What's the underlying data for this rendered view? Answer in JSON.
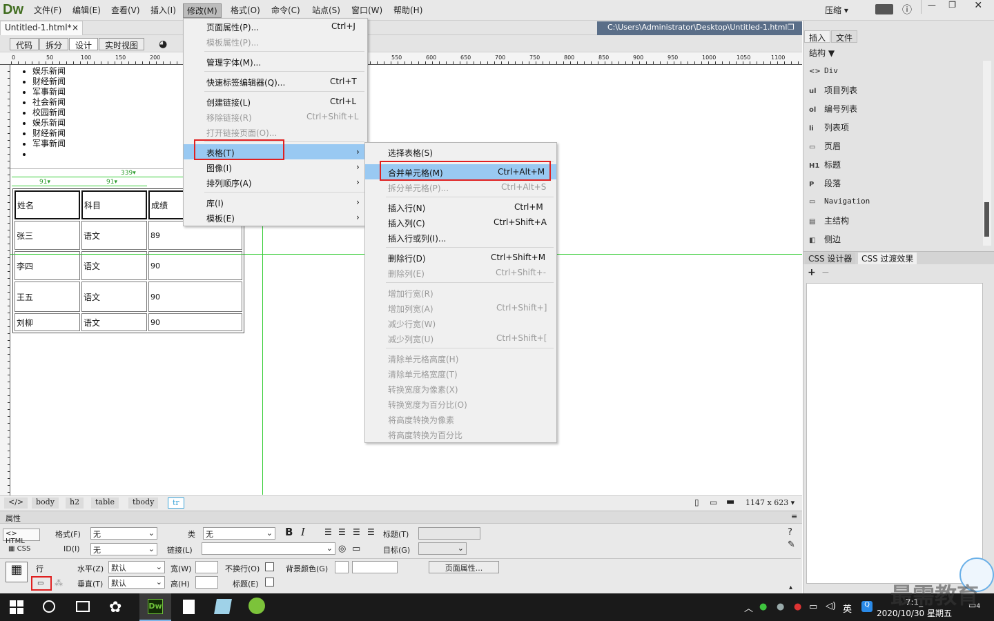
{
  "app": {
    "logo": "Dw",
    "compress": "压缩",
    "compress_arrow": "▾"
  },
  "menubar": [
    "文件(F)",
    "编辑(E)",
    "查看(V)",
    "插入(I)",
    "修改(M)",
    "格式(O)",
    "命令(C)",
    "站点(S)",
    "窗口(W)",
    "帮助(H)"
  ],
  "document": {
    "tab": "Untitled-1.html*",
    "path": "C:\\Users\\Administrator\\Desktop\\Untitled-1.html"
  },
  "view_buttons": [
    "代码",
    "拆分",
    "设计",
    "实时视图"
  ],
  "ruler_marks": [
    "0",
    "50",
    "100",
    "150",
    "200",
    "550",
    "600",
    "650",
    "700",
    "750",
    "800",
    "850",
    "900",
    "950",
    "1000",
    "1050",
    "1100"
  ],
  "list_items": [
    "娱乐新闻",
    "财经新闻",
    "军事新闻",
    "社会新闻",
    "校园新闻",
    "娱乐新闻",
    "财经新闻",
    "军事新闻",
    ""
  ],
  "table_widths": {
    "total": "339",
    "col1": "91",
    "col2": "91"
  },
  "table": [
    [
      "姓名",
      "科目",
      "成绩"
    ],
    [
      "张三",
      "语文",
      "89"
    ],
    [
      "李四",
      "语文",
      "90"
    ],
    [
      "王五",
      "语文",
      "90"
    ],
    [
      "刘柳",
      "语文",
      "90"
    ]
  ],
  "modify_menu": [
    {
      "label": "页面属性(P)...",
      "shortcut": "Ctrl+J",
      "disabled": false
    },
    {
      "label": "模板属性(P)...",
      "shortcut": "",
      "disabled": true
    },
    {
      "label": "管理字体(M)...",
      "shortcut": "",
      "disabled": false
    },
    {
      "label": "快速标签编辑器(Q)...",
      "shortcut": "Ctrl+T",
      "disabled": false
    },
    {
      "label": "创建链接(L)",
      "shortcut": "Ctrl+L",
      "disabled": false
    },
    {
      "label": "移除链接(R)",
      "shortcut": "Ctrl+Shift+L",
      "disabled": true
    },
    {
      "label": "打开链接页面(O)...",
      "shortcut": "",
      "disabled": true
    },
    {
      "label": "表格(T)",
      "shortcut": "›",
      "disabled": false
    },
    {
      "label": "图像(I)",
      "shortcut": "›",
      "disabled": false
    },
    {
      "label": "排列顺序(A)",
      "shortcut": "›",
      "disabled": false
    },
    {
      "label": "库(I)",
      "shortcut": "›",
      "disabled": false
    },
    {
      "label": "模板(E)",
      "shortcut": "›",
      "disabled": false
    }
  ],
  "table_submenu": [
    {
      "label": "选择表格(S)",
      "shortcut": "",
      "disabled": false
    },
    {
      "label": "合并单元格(M)",
      "shortcut": "Ctrl+Alt+M",
      "disabled": false
    },
    {
      "label": "拆分单元格(P)...",
      "shortcut": "Ctrl+Alt+S",
      "disabled": true
    },
    {
      "label": "插入行(N)",
      "shortcut": "Ctrl+M",
      "disabled": false
    },
    {
      "label": "插入列(C)",
      "shortcut": "Ctrl+Shift+A",
      "disabled": false
    },
    {
      "label": "插入行或列(I)...",
      "shortcut": "",
      "disabled": false
    },
    {
      "label": "删除行(D)",
      "shortcut": "Ctrl+Shift+M",
      "disabled": false
    },
    {
      "label": "删除列(E)",
      "shortcut": "Ctrl+Shift+-",
      "disabled": true
    },
    {
      "label": "增加行宽(R)",
      "shortcut": "",
      "disabled": true
    },
    {
      "label": "增加列宽(A)",
      "shortcut": "Ctrl+Shift+]",
      "disabled": true
    },
    {
      "label": "减少行宽(W)",
      "shortcut": "",
      "disabled": true
    },
    {
      "label": "减少列宽(U)",
      "shortcut": "Ctrl+Shift+[",
      "disabled": true
    },
    {
      "label": "清除单元格高度(H)",
      "shortcut": "",
      "disabled": true
    },
    {
      "label": "清除单元格宽度(T)",
      "shortcut": "",
      "disabled": true
    },
    {
      "label": "转换宽度为像素(X)",
      "shortcut": "",
      "disabled": true
    },
    {
      "label": "转换宽度为百分比(O)",
      "shortcut": "",
      "disabled": true
    },
    {
      "label": "将高度转换为像素",
      "shortcut": "",
      "disabled": true
    },
    {
      "label": "将高度转换为百分比",
      "shortcut": "",
      "disabled": true
    }
  ],
  "tag_selector": [
    "</>",
    "body",
    "h2",
    "table",
    "tbody",
    "tr"
  ],
  "window_size": "1147 x 623 ▾",
  "properties": {
    "title": "属性",
    "html": "HTML",
    "css": "CSS",
    "format_label": "格式(F)",
    "format_value": "无",
    "class_label": "类",
    "class_value": "无",
    "id_label": "ID(I)",
    "id_value": "无",
    "link_label": "链接(L)",
    "title_label": "标题(T)",
    "target_label": "目标(G)",
    "row_label": "行",
    "horz_label": "水平(Z)",
    "horz_value": "默认",
    "vert_label": "垂直(T)",
    "vert_value": "默认",
    "width_label": "宽(W)",
    "height_label": "高(H)",
    "nowrap_label": "不换行(O)",
    "header_label": "标题(E)",
    "bg_label": "背景颜色(G)",
    "page_props": "页面属性..."
  },
  "right_panel": {
    "tabs": [
      "插入",
      "文件"
    ],
    "structure": "结构",
    "items": [
      {
        "icon": "<>",
        "label": "Div"
      },
      {
        "icon": "ul",
        "label": "项目列表"
      },
      {
        "icon": "ol",
        "label": "编号列表"
      },
      {
        "icon": "li",
        "label": "列表项"
      },
      {
        "icon": "▭",
        "label": "页眉"
      },
      {
        "icon": "H1",
        "label": "标题"
      },
      {
        "icon": "P",
        "label": "段落"
      },
      {
        "icon": "▭",
        "label": "Navigation"
      },
      {
        "icon": "▤",
        "label": "主结构"
      },
      {
        "icon": "◧",
        "label": "侧边"
      }
    ],
    "css_tabs": [
      "CSS 设计器",
      "CSS 过渡效果"
    ]
  },
  "taskbar": {
    "time": "7:1_",
    "date": "2020/10/30 星期五",
    "ime": "英",
    "notify": "4"
  },
  "watermark": "最需教育",
  "colors": {
    "menu_highlight": "#99c9f2",
    "red_box": "#e02020",
    "guide_green": "#33cc33"
  }
}
